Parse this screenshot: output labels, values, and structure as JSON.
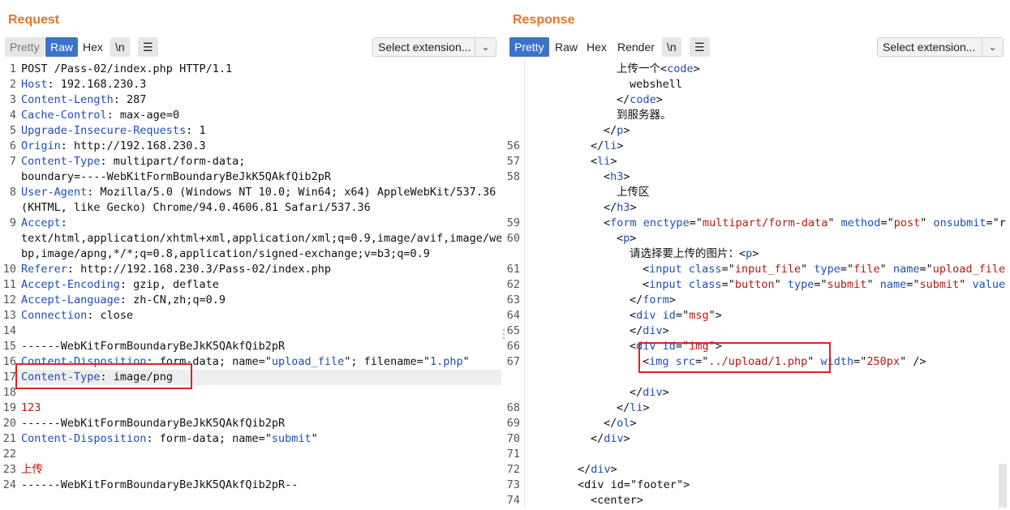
{
  "request": {
    "title": "Request",
    "tabs": {
      "pretty": "Pretty",
      "raw": "Raw",
      "hex": "Hex",
      "newline": "\\n",
      "menu": "☰"
    },
    "select_extension": "Select extension...",
    "lines": [
      {
        "n": "1",
        "segs": [
          [
            "POST /Pass-02/index.php HTTP/1.1",
            ""
          ]
        ]
      },
      {
        "n": "2",
        "segs": [
          [
            "Host",
            "k"
          ],
          [
            ": 192.168.230.3",
            ""
          ]
        ]
      },
      {
        "n": "3",
        "segs": [
          [
            "Content-Length",
            "k"
          ],
          [
            ": 287",
            ""
          ]
        ]
      },
      {
        "n": "4",
        "segs": [
          [
            "Cache-Control",
            "k"
          ],
          [
            ": max-age=0",
            ""
          ]
        ]
      },
      {
        "n": "5",
        "segs": [
          [
            "Upgrade-Insecure-Requests",
            "k"
          ],
          [
            ": 1",
            ""
          ]
        ]
      },
      {
        "n": "6",
        "segs": [
          [
            "Origin",
            "k"
          ],
          [
            ": http://192.168.230.3",
            ""
          ]
        ]
      },
      {
        "n": "7",
        "segs": [
          [
            "Content-Type",
            "k"
          ],
          [
            ": multipart/form-data;",
            ""
          ]
        ]
      },
      {
        "n": "",
        "segs": [
          [
            "boundary=----WebKitFormBoundaryBeJkK5QAkfQib2pR",
            ""
          ]
        ]
      },
      {
        "n": "8",
        "segs": [
          [
            "User-Agent",
            "k"
          ],
          [
            ": Mozilla/5.0 (Windows NT 10.0; Win64; x64) AppleWebKit/537.36",
            ""
          ]
        ]
      },
      {
        "n": "",
        "segs": [
          [
            "(KHTML, like Gecko) Chrome/94.0.4606.81 Safari/537.36",
            ""
          ]
        ]
      },
      {
        "n": "9",
        "segs": [
          [
            "Accept",
            "k"
          ],
          [
            ":",
            ""
          ]
        ]
      },
      {
        "n": "",
        "segs": [
          [
            "text/html,application/xhtml+xml,application/xml;q=0.9,image/avif,image/we",
            ""
          ]
        ]
      },
      {
        "n": "",
        "segs": [
          [
            "bp,image/apng,*/*;q=0.8,application/signed-exchange;v=b3;q=0.9",
            ""
          ]
        ]
      },
      {
        "n": "10",
        "segs": [
          [
            "Referer",
            "k"
          ],
          [
            ": http://192.168.230.3/Pass-02/index.php",
            ""
          ]
        ]
      },
      {
        "n": "11",
        "segs": [
          [
            "Accept-Encoding",
            "k"
          ],
          [
            ": gzip, deflate",
            ""
          ]
        ]
      },
      {
        "n": "12",
        "segs": [
          [
            "Accept-Language",
            "k"
          ],
          [
            ": zh-CN,zh;q=0.9",
            ""
          ]
        ]
      },
      {
        "n": "13",
        "segs": [
          [
            "Connection",
            "k"
          ],
          [
            ": close",
            ""
          ]
        ]
      },
      {
        "n": "14",
        "segs": [
          [
            "",
            ""
          ]
        ]
      },
      {
        "n": "15",
        "segs": [
          [
            "------WebKitFormBoundaryBeJkK5QAkfQib2pR",
            ""
          ]
        ]
      },
      {
        "n": "16",
        "segs": [
          [
            "Content-Disposition",
            "k"
          ],
          [
            ": form-data; name=\"",
            ""
          ],
          [
            "upload_file",
            "s"
          ],
          [
            "\"; filename=\"",
            ""
          ],
          [
            "1.php",
            "s"
          ],
          [
            "\"",
            ""
          ]
        ]
      },
      {
        "n": "17",
        "segs": [
          [
            "Content-Type",
            "k"
          ],
          [
            ": image/png",
            ""
          ]
        ]
      },
      {
        "n": "18",
        "segs": [
          [
            "",
            ""
          ]
        ]
      },
      {
        "n": "19",
        "segs": [
          [
            "123",
            "r"
          ]
        ]
      },
      {
        "n": "20",
        "segs": [
          [
            "------WebKitFormBoundaryBeJkK5QAkfQib2pR",
            ""
          ]
        ]
      },
      {
        "n": "21",
        "segs": [
          [
            "Content-Disposition",
            "k"
          ],
          [
            ": form-data; name=\"",
            ""
          ],
          [
            "submit",
            "s"
          ],
          [
            "\"",
            ""
          ]
        ]
      },
      {
        "n": "22",
        "segs": [
          [
            "",
            ""
          ]
        ]
      },
      {
        "n": "23",
        "segs": [
          [
            "上传",
            "r"
          ]
        ]
      },
      {
        "n": "24",
        "segs": [
          [
            "------WebKitFormBoundaryBeJkK5QAkfQib2pR--",
            ""
          ]
        ]
      }
    ]
  },
  "response": {
    "title": "Response",
    "tabs": {
      "pretty": "Pretty",
      "raw": "Raw",
      "hex": "Hex",
      "render": "Render",
      "newline": "\\n",
      "menu": "☰"
    },
    "select_extension": "Select extension...",
    "lines": [
      {
        "n": "",
        "i": 136,
        "segs": [
          [
            "上传一个<",
            ""
          ],
          [
            "code",
            "t"
          ],
          [
            ">",
            ""
          ]
        ]
      },
      {
        "n": "",
        "i": 152,
        "segs": [
          [
            "webshell",
            ""
          ]
        ]
      },
      {
        "n": "",
        "i": 136,
        "segs": [
          [
            "</",
            ""
          ],
          [
            "code",
            "t"
          ],
          [
            ">",
            ""
          ]
        ]
      },
      {
        "n": "",
        "i": 136,
        "segs": [
          [
            "到服务器。",
            ""
          ]
        ]
      },
      {
        "n": "",
        "i": 120,
        "segs": [
          [
            "</",
            ""
          ],
          [
            "p",
            "t"
          ],
          [
            ">",
            ""
          ]
        ]
      },
      {
        "n": "56",
        "i": 104,
        "segs": [
          [
            "</",
            ""
          ],
          [
            "li",
            "t"
          ],
          [
            ">",
            ""
          ]
        ]
      },
      {
        "n": "57",
        "i": 104,
        "segs": [
          [
            "<",
            ""
          ],
          [
            "li",
            "t"
          ],
          [
            ">",
            ""
          ]
        ]
      },
      {
        "n": "58",
        "i": 120,
        "segs": [
          [
            "<",
            ""
          ],
          [
            "h3",
            "t"
          ],
          [
            ">",
            ""
          ]
        ]
      },
      {
        "n": "",
        "i": 136,
        "segs": [
          [
            "上传区",
            ""
          ]
        ]
      },
      {
        "n": "",
        "i": 120,
        "segs": [
          [
            "</",
            ""
          ],
          [
            "h3",
            "t"
          ],
          [
            ">",
            ""
          ]
        ]
      },
      {
        "n": "59",
        "i": 120,
        "segs": [
          [
            "<",
            ""
          ],
          [
            "form",
            "t"
          ],
          [
            " ",
            ""
          ],
          [
            "enctype",
            "t"
          ],
          [
            "=\"",
            ""
          ],
          [
            "multipart/form-data",
            "r"
          ],
          [
            "\" ",
            ""
          ],
          [
            "method",
            "t"
          ],
          [
            "=\"",
            ""
          ],
          [
            "post",
            "r"
          ],
          [
            "\" ",
            ""
          ],
          [
            "onsubmit",
            "t"
          ],
          [
            "=\"r",
            ""
          ]
        ]
      },
      {
        "n": "60",
        "i": 136,
        "segs": [
          [
            "<",
            ""
          ],
          [
            "p",
            "t"
          ],
          [
            ">",
            ""
          ]
        ]
      },
      {
        "n": "",
        "i": 152,
        "segs": [
          [
            "请选择要上传的图片：<",
            ""
          ],
          [
            "p",
            "t"
          ],
          [
            ">",
            ""
          ]
        ]
      },
      {
        "n": "61",
        "i": 168,
        "segs": [
          [
            "<",
            ""
          ],
          [
            "input",
            "t"
          ],
          [
            " ",
            ""
          ],
          [
            "class",
            "t"
          ],
          [
            "=\"",
            ""
          ],
          [
            "input_file",
            "r"
          ],
          [
            "\" ",
            ""
          ],
          [
            "type",
            "t"
          ],
          [
            "=\"",
            ""
          ],
          [
            "file",
            "r"
          ],
          [
            "\" ",
            ""
          ],
          [
            "name",
            "t"
          ],
          [
            "=\"",
            ""
          ],
          [
            "upload_file",
            "r"
          ]
        ]
      },
      {
        "n": "62",
        "i": 168,
        "segs": [
          [
            "<",
            ""
          ],
          [
            "input",
            "t"
          ],
          [
            " ",
            ""
          ],
          [
            "class",
            "t"
          ],
          [
            "=\"",
            ""
          ],
          [
            "button",
            "r"
          ],
          [
            "\" ",
            ""
          ],
          [
            "type",
            "t"
          ],
          [
            "=\"",
            ""
          ],
          [
            "submit",
            "r"
          ],
          [
            "\" ",
            ""
          ],
          [
            "name",
            "t"
          ],
          [
            "=\"",
            ""
          ],
          [
            "submit",
            "r"
          ],
          [
            "\" ",
            ""
          ],
          [
            "value",
            "t"
          ]
        ]
      },
      {
        "n": "63",
        "i": 152,
        "segs": [
          [
            "</",
            ""
          ],
          [
            "form",
            "t"
          ],
          [
            ">",
            ""
          ]
        ]
      },
      {
        "n": "64",
        "i": 152,
        "segs": [
          [
            "<",
            ""
          ],
          [
            "div",
            "t"
          ],
          [
            " ",
            ""
          ],
          [
            "id",
            "t"
          ],
          [
            "=\"",
            ""
          ],
          [
            "msg",
            "r"
          ],
          [
            "\">",
            ""
          ]
        ]
      },
      {
        "n": "65",
        "i": 152,
        "segs": [
          [
            "</",
            ""
          ],
          [
            "div",
            "t"
          ],
          [
            ">",
            ""
          ]
        ]
      },
      {
        "n": "66",
        "i": 152,
        "segs": [
          [
            "<",
            ""
          ],
          [
            "div",
            "t"
          ],
          [
            " ",
            ""
          ],
          [
            "id",
            "t"
          ],
          [
            "=\"",
            ""
          ],
          [
            "img",
            "r"
          ],
          [
            "\">",
            ""
          ]
        ]
      },
      {
        "n": "67",
        "i": 168,
        "segs": [
          [
            "<",
            ""
          ],
          [
            "img",
            "t"
          ],
          [
            " ",
            ""
          ],
          [
            "src",
            "t"
          ],
          [
            "=\"",
            ""
          ],
          [
            "../upload/1.php",
            "r"
          ],
          [
            "\" ",
            ""
          ],
          [
            "width",
            "t"
          ],
          [
            "=\"",
            ""
          ],
          [
            "250px",
            "r"
          ],
          [
            "\" />",
            ""
          ]
        ]
      },
      {
        "n": "",
        "i": 152,
        "segs": [
          [
            "",
            ""
          ]
        ]
      },
      {
        "n": "",
        "i": 152,
        "segs": [
          [
            "</",
            ""
          ],
          [
            "div",
            "t"
          ],
          [
            ">",
            ""
          ]
        ]
      },
      {
        "n": "68",
        "i": 136,
        "segs": [
          [
            "</",
            ""
          ],
          [
            "li",
            "t"
          ],
          [
            ">",
            ""
          ]
        ]
      },
      {
        "n": "69",
        "i": 120,
        "segs": [
          [
            "</",
            ""
          ],
          [
            "ol",
            "t"
          ],
          [
            ">",
            ""
          ]
        ]
      },
      {
        "n": "70",
        "i": 104,
        "segs": [
          [
            "</",
            ""
          ],
          [
            "div",
            "t"
          ],
          [
            ">",
            ""
          ]
        ]
      },
      {
        "n": "71",
        "i": 88,
        "segs": [
          [
            "",
            ""
          ]
        ]
      },
      {
        "n": "72",
        "i": 88,
        "segs": [
          [
            "</",
            ""
          ],
          [
            "div",
            "t"
          ],
          [
            ">",
            ""
          ]
        ]
      },
      {
        "n": "73",
        "i": 88,
        "segs": [
          [
            "<",
            ""
          ],
          [
            "div",
            ""
          ],
          [
            " id=\"",
            ""
          ],
          [
            "footer",
            ""
          ],
          [
            "\">",
            ""
          ]
        ]
      },
      {
        "n": "74",
        "i": 104,
        "segs": [
          [
            "<",
            ""
          ],
          [
            "center",
            ""
          ],
          [
            ">",
            ""
          ]
        ]
      }
    ]
  },
  "colors": {
    "accent": "#e8742a",
    "active_tab": "#3d72c6",
    "highlight": "#d8262a"
  }
}
